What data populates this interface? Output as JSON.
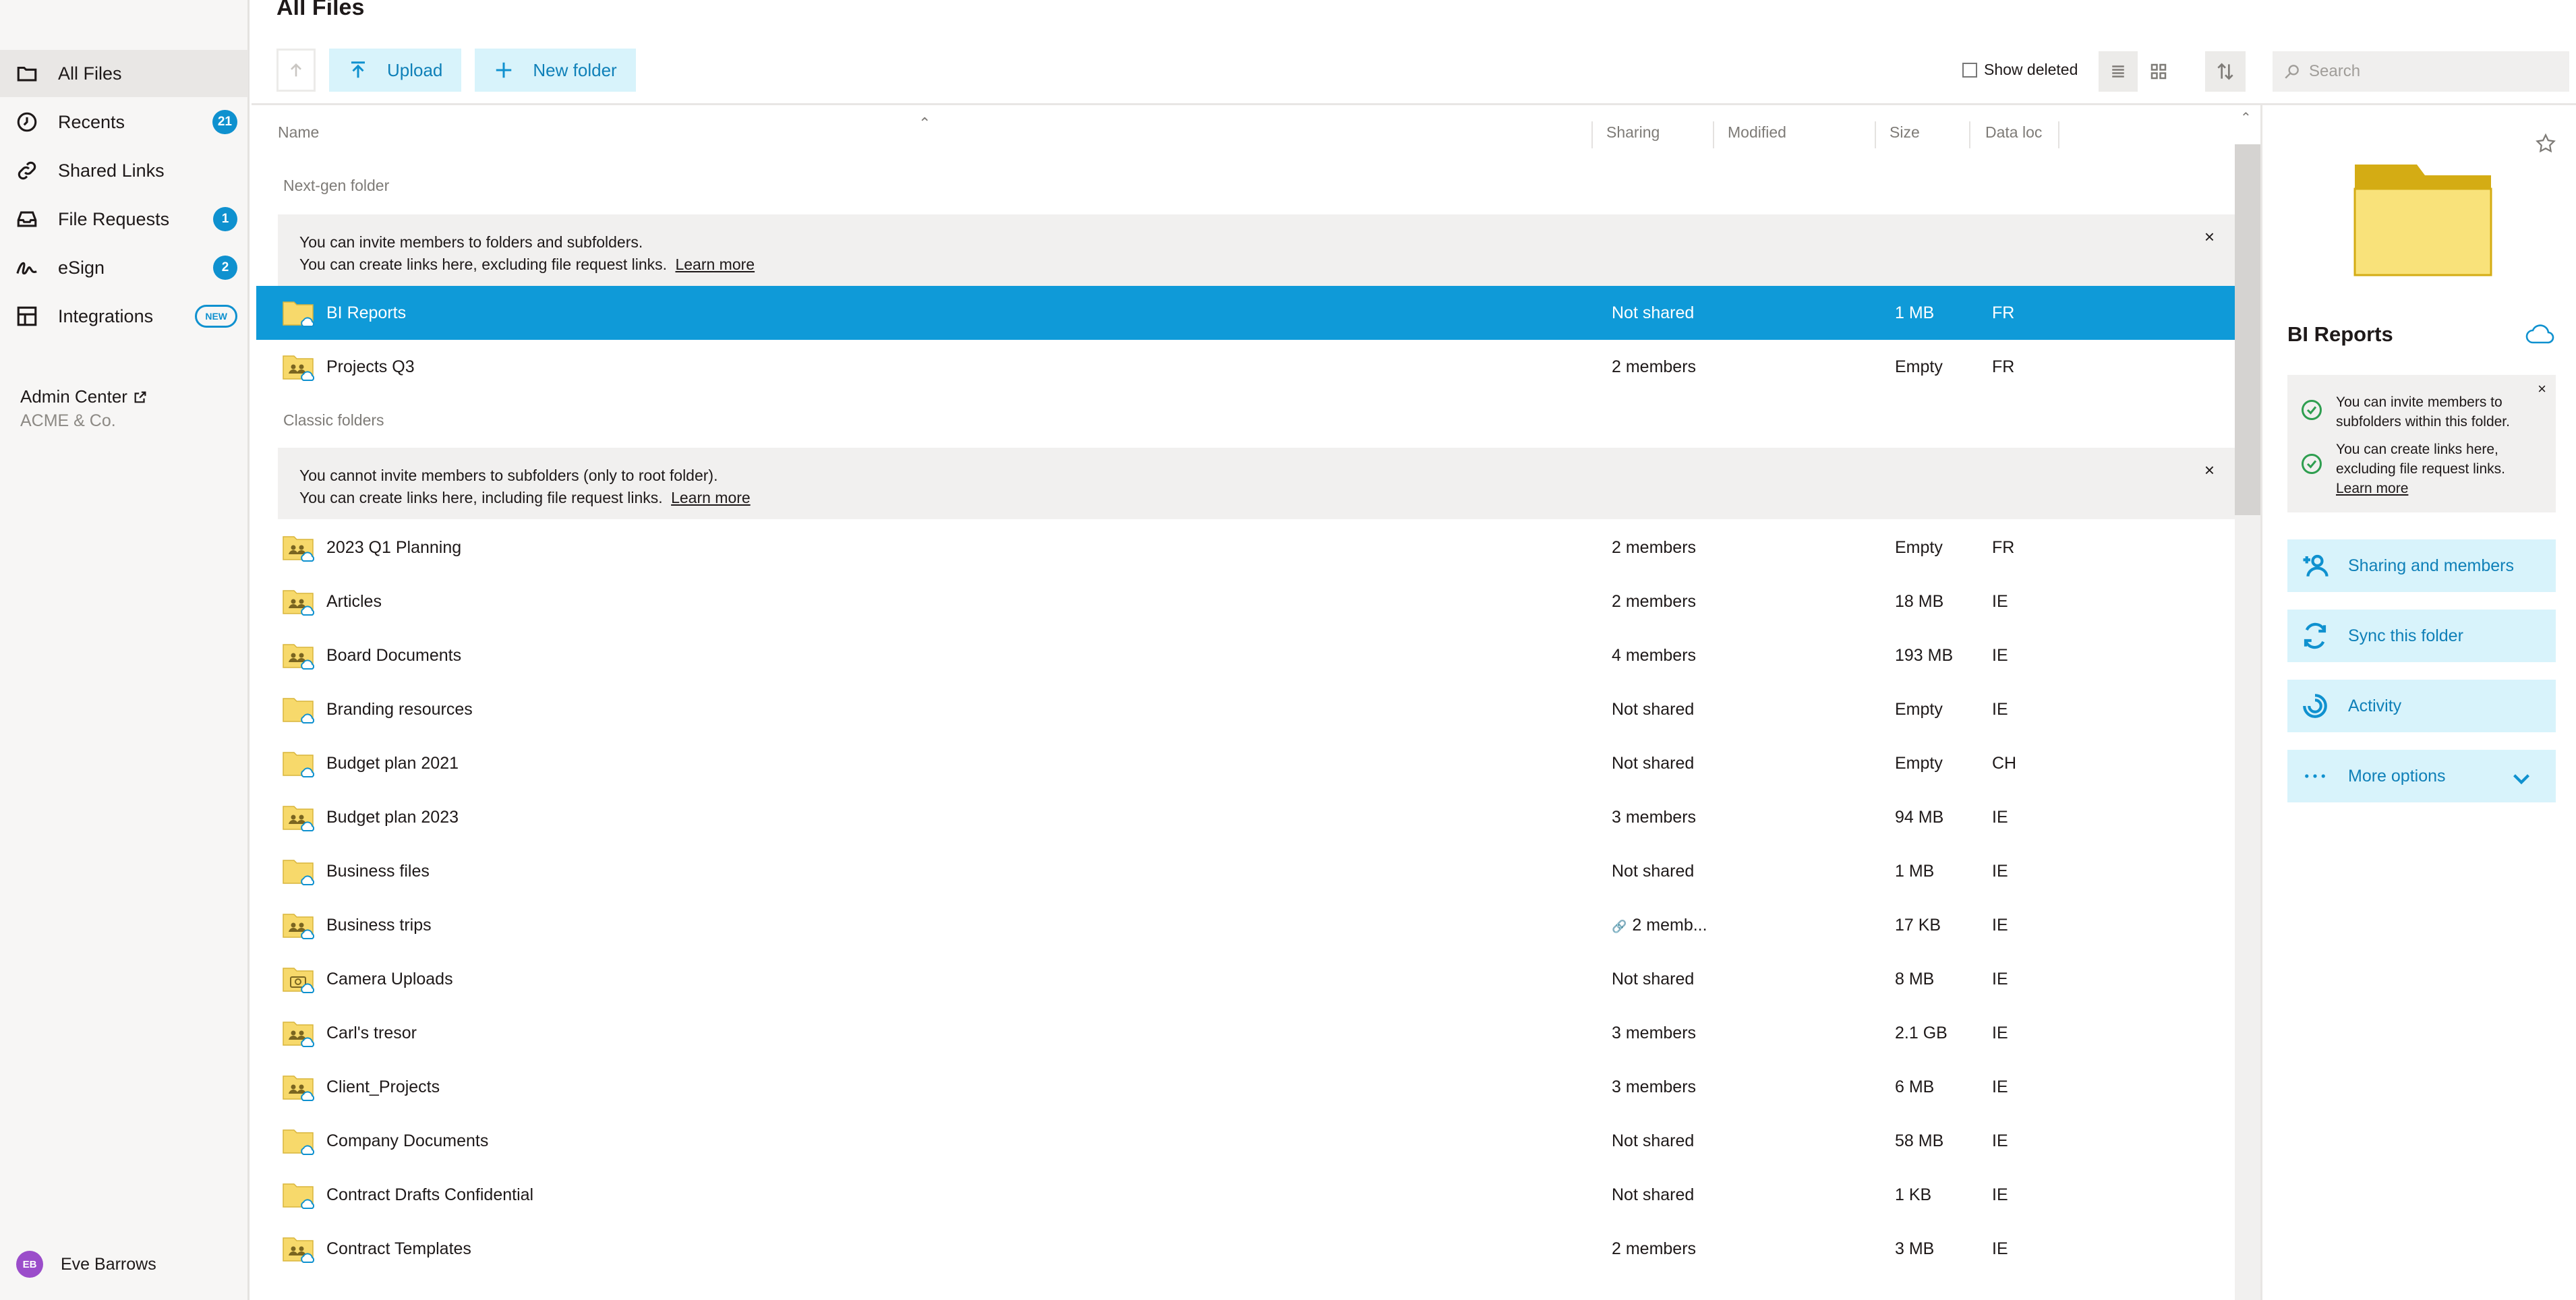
{
  "sidebar": {
    "items": [
      {
        "label": "All Files",
        "icon": "folder-icon"
      },
      {
        "label": "Recents",
        "icon": "clock-icon",
        "badge": "21"
      },
      {
        "label": "Shared Links",
        "icon": "link-icon"
      },
      {
        "label": "File Requests",
        "icon": "inbox-icon",
        "badge": "1"
      },
      {
        "label": "eSign",
        "icon": "signature-icon",
        "badge": "2"
      },
      {
        "label": "Integrations",
        "icon": "integrations-icon",
        "badge": "NEW"
      }
    ],
    "admin_center": "Admin Center",
    "admin_sub": "ACME & Co.",
    "user_initials": "EB",
    "user_name": "Eve Barrows"
  },
  "header": {
    "title": "All Files",
    "upload_label": "Upload",
    "new_folder_label": "New folder",
    "show_deleted_label": "Show deleted",
    "search_placeholder": "Search"
  },
  "columns": {
    "name": "Name",
    "sharing": "Sharing",
    "modified": "Modified",
    "size": "Size",
    "data_loc": "Data loc"
  },
  "sections": {
    "nextgen": {
      "label": "Next-gen folder",
      "line1": "You can invite members to folders and subfolders.",
      "line2": "You can create links here, excluding file request links.",
      "learn_more": "Learn more",
      "rows": [
        {
          "name": "BI Reports",
          "sharing": "Not shared",
          "size": "1 MB",
          "loc": "FR",
          "type": "plain"
        },
        {
          "name": "Projects Q3",
          "sharing": "2 members",
          "size": "Empty",
          "loc": "FR",
          "type": "shared"
        }
      ]
    },
    "classic": {
      "label": "Classic folders",
      "line1": "You cannot invite members to subfolders (only to root folder).",
      "line2": "You can create links here, including file request links.",
      "learn_more": "Learn more",
      "rows": [
        {
          "name": "2023 Q1 Planning",
          "sharing": "2 members",
          "size": "Empty",
          "loc": "FR",
          "type": "shared"
        },
        {
          "name": "Articles",
          "sharing": "2 members",
          "size": "18 MB",
          "loc": "IE",
          "type": "shared"
        },
        {
          "name": "Board Documents",
          "sharing": "4 members",
          "size": "193 MB",
          "loc": "IE",
          "type": "shared"
        },
        {
          "name": "Branding resources",
          "sharing": "Not shared",
          "size": "Empty",
          "loc": "IE",
          "type": "plain"
        },
        {
          "name": "Budget plan 2021",
          "sharing": "Not shared",
          "size": "Empty",
          "loc": "CH",
          "type": "plain"
        },
        {
          "name": "Budget plan 2023",
          "sharing": "3 members",
          "size": "94 MB",
          "loc": "IE",
          "type": "shared"
        },
        {
          "name": "Business files",
          "sharing": "Not shared",
          "size": "1 MB",
          "loc": "IE",
          "type": "plain"
        },
        {
          "name": "Business trips",
          "sharing": "2 memb...",
          "size": "17 KB",
          "loc": "IE",
          "type": "shared",
          "link": true
        },
        {
          "name": "Camera Uploads",
          "sharing": "Not shared",
          "size": "8 MB",
          "loc": "IE",
          "type": "camera"
        },
        {
          "name": "Carl's tresor",
          "sharing": "3 members",
          "size": "2.1 GB",
          "loc": "IE",
          "type": "shared"
        },
        {
          "name": "Client_Projects",
          "sharing": "3 members",
          "size": "6 MB",
          "loc": "IE",
          "type": "shared"
        },
        {
          "name": "Company Documents",
          "sharing": "Not shared",
          "size": "58 MB",
          "loc": "IE",
          "type": "plain"
        },
        {
          "name": "Contract Drafts Confidential",
          "sharing": "Not shared",
          "size": "1 KB",
          "loc": "IE",
          "type": "plain"
        },
        {
          "name": "Contract Templates",
          "sharing": "2 members",
          "size": "3 MB",
          "loc": "IE",
          "type": "shared"
        }
      ]
    }
  },
  "details": {
    "title": "BI Reports",
    "info1": "You can invite members to subfolders within this folder.",
    "info2": "You can create links here, excluding file request links.",
    "learn_more": "Learn more",
    "sharing_btn": "Sharing and members",
    "sync_btn": "Sync this folder",
    "activity_btn": "Activity",
    "more_btn": "More options"
  },
  "colors": {
    "accent": "#0f91cf",
    "selected_row": "#0f9ad8",
    "button_bg": "#d8f3fb",
    "folder_yellow": "#f7d96b"
  }
}
